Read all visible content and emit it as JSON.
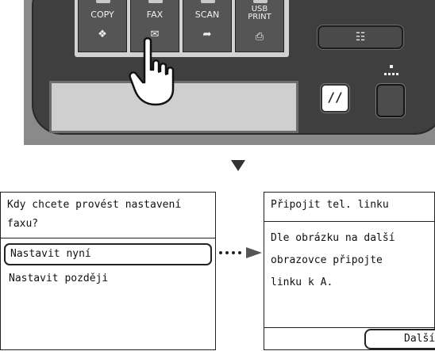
{
  "panel": {
    "mode_buttons": [
      {
        "label": "COPY",
        "icon": "copy-icon",
        "icon_glyph": "❖"
      },
      {
        "label": "FAX",
        "icon": "fax-icon",
        "icon_glyph": "✉"
      },
      {
        "label": "SCAN",
        "icon": "scan-icon",
        "icon_glyph": "➦"
      },
      {
        "label_line1": "USB",
        "label_line2": "PRINT",
        "icon": "usb-print-icon",
        "icon_glyph": "⎙"
      }
    ],
    "book_button_glyph": "☷",
    "stop_button_glyph": "//",
    "dots_glyph": "■\n▪▪▪▪"
  },
  "screen_left": {
    "title": "Kdy chcete provést nastavení faxu?",
    "options": [
      "Nastavit nyní",
      "Nastavit později"
    ]
  },
  "screen_right": {
    "title": "Připojit tel. linku",
    "body_lines": [
      "Dle obrázku na další",
      "obrazovce připojte",
      "linku k A."
    ],
    "next_button": "Další"
  },
  "colors": {
    "panel_bg": "#3f3f3f",
    "button_bg": "#555555",
    "outer_bg": "#8a8a8a"
  }
}
